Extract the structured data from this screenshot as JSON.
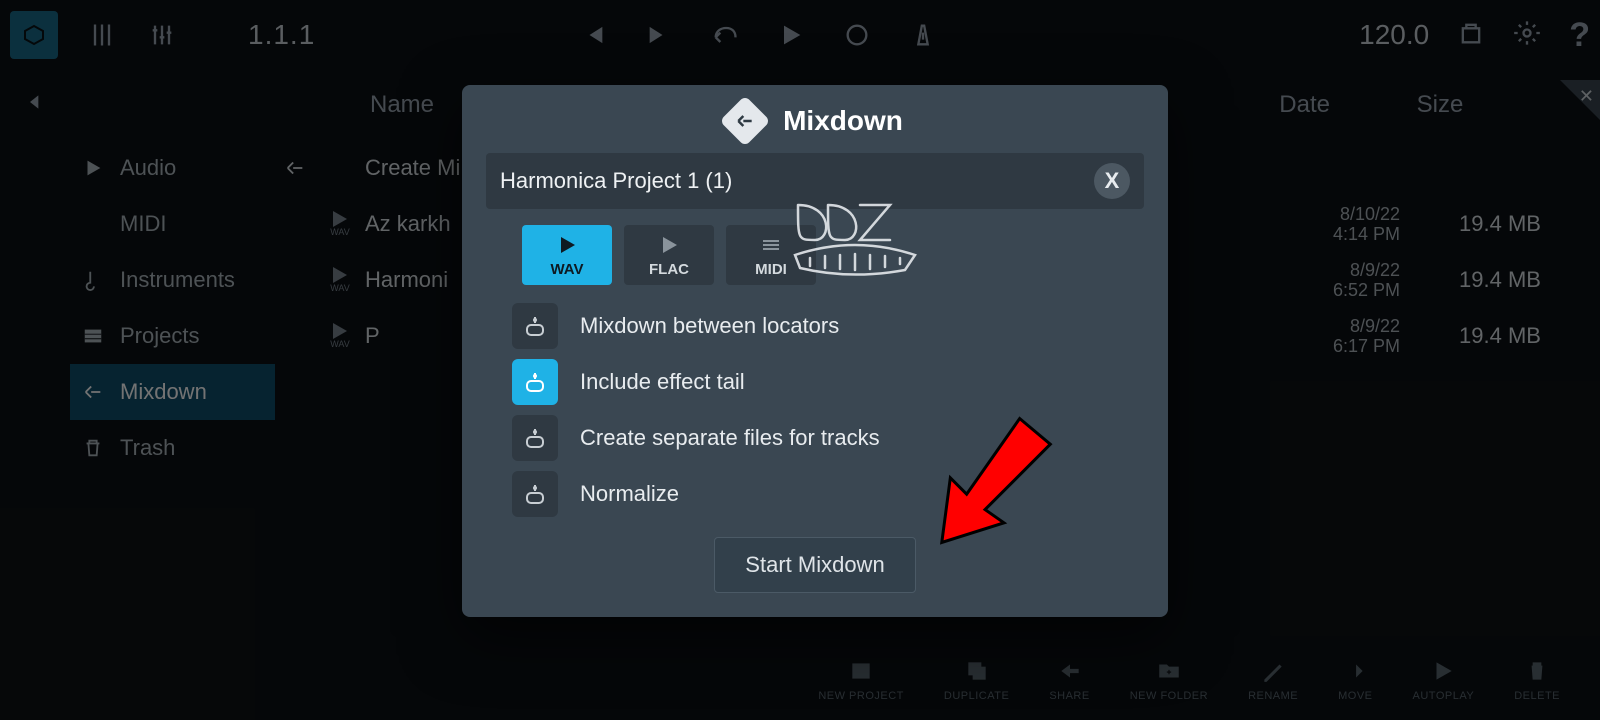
{
  "topbar": {
    "position": "1.1.1",
    "tempo": "120.0"
  },
  "columns": {
    "name": "Name",
    "date": "Date",
    "size": "Size"
  },
  "sidebar": {
    "items": [
      {
        "label": "Audio"
      },
      {
        "label": "MIDI"
      },
      {
        "label": "Instruments"
      },
      {
        "label": "Projects"
      },
      {
        "label": "Mixdown"
      },
      {
        "label": "Trash"
      }
    ]
  },
  "files": {
    "create_label": "Create Mi",
    "rows": [
      {
        "name": "Az karkh",
        "date1": "8/10/22",
        "date2": "4:14 PM",
        "size": "19.4 MB"
      },
      {
        "name": "Harmoni",
        "date1": "8/9/22",
        "date2": "6:52 PM",
        "size": "19.4 MB"
      },
      {
        "name": "P",
        "date1": "8/9/22",
        "date2": "6:17 PM",
        "size": "19.4 MB"
      }
    ]
  },
  "bottombar": {
    "items": [
      {
        "label": "NEW PROJECT"
      },
      {
        "label": "DUPLICATE"
      },
      {
        "label": "SHARE"
      },
      {
        "label": "NEW FOLDER"
      },
      {
        "label": "RENAME"
      },
      {
        "label": "MOVE"
      },
      {
        "label": "AUTOPLAY"
      },
      {
        "label": "DELETE"
      }
    ]
  },
  "modal": {
    "title": "Mixdown",
    "filename": "Harmonica Project 1 (1)",
    "clear": "X",
    "formats": [
      {
        "label": "WAV",
        "selected": true,
        "kind": "play"
      },
      {
        "label": "FLAC",
        "selected": false,
        "kind": "play"
      },
      {
        "label": "MIDI",
        "selected": false,
        "kind": "midi"
      }
    ],
    "options": [
      {
        "label": "Mixdown between locators",
        "on": false
      },
      {
        "label": "Include effect tail",
        "on": true
      },
      {
        "label": "Create separate files for tracks",
        "on": false
      },
      {
        "label": "Normalize",
        "on": false
      }
    ],
    "start": "Start Mixdown"
  }
}
